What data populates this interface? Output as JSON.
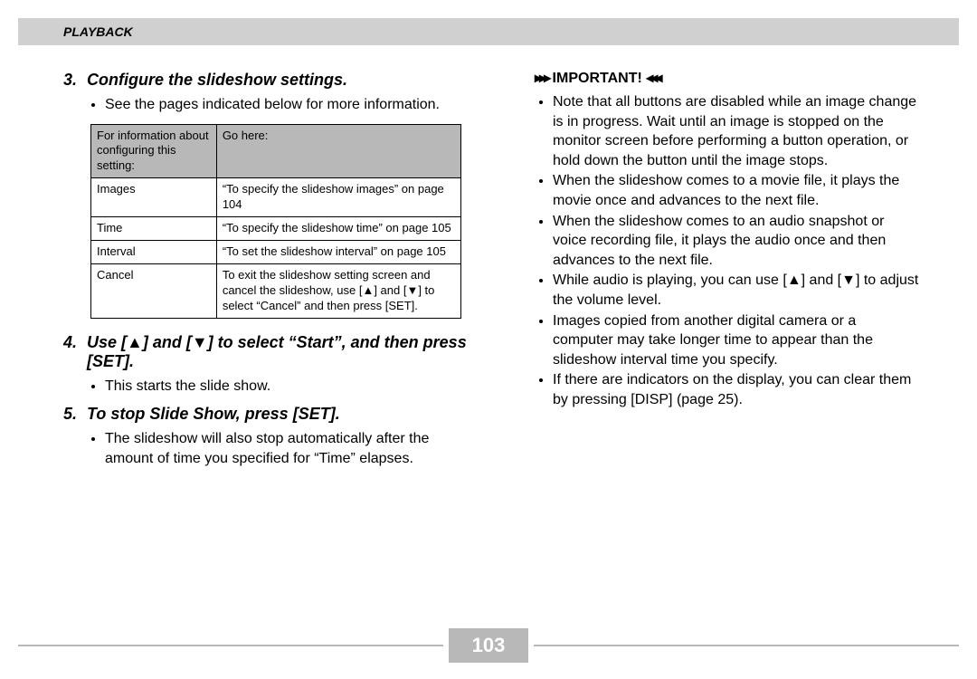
{
  "header": {
    "section": "PLAYBACK"
  },
  "left": {
    "step3": {
      "num": "3.",
      "title": "Configure the slideshow settings.",
      "bullet1": "See the pages indicated below for more information."
    },
    "table": {
      "h1": "For information about configuring this setting:",
      "h2": "Go here:",
      "rows": [
        {
          "c1": "Images",
          "c2": "“To specify the slideshow images” on page 104"
        },
        {
          "c1": "Time",
          "c2": "“To specify the slideshow time” on page 105"
        },
        {
          "c1": "Interval",
          "c2": "“To set the slideshow interval” on page 105"
        },
        {
          "c1": "Cancel",
          "c2": "To exit the slideshow setting screen and cancel the slideshow, use [▲] and [▼] to select “Cancel” and then press [SET]."
        }
      ]
    },
    "step4": {
      "num": "4.",
      "title": "Use [▲] and [▼] to select “Start”, and then press [SET].",
      "bullet1": "This starts the slide show."
    },
    "step5": {
      "num": "5.",
      "title": "To stop Slide Show, press [SET].",
      "bullet1": "The slideshow will also stop automatically after the amount of time you specified for “Time” elapses."
    }
  },
  "right": {
    "important_label": "IMPORTANT!",
    "items": [
      "Note that all buttons are disabled while an image change is in progress. Wait until an image is stopped on the monitor screen before performing a button operation, or hold down the button until the image stops.",
      "When the slideshow comes to a movie file, it plays the movie once and advances to the next file.",
      "When the slideshow comes to an audio snapshot or voice recording file, it plays the audio once and then advances to the next file.",
      "While audio is playing, you can use [▲] and [▼] to adjust the volume level.",
      "Images copied from another digital camera or a computer may take longer time to appear than the slideshow interval time you specify.",
      "If there are indicators on the display, you can clear them by pressing [DISP] (page 25)."
    ]
  },
  "page_number": "103"
}
